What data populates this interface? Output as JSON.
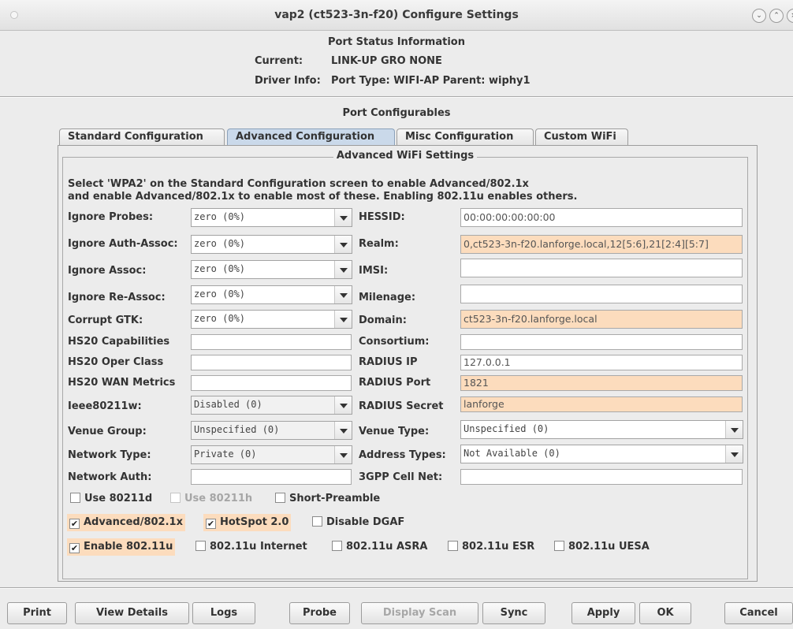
{
  "window": {
    "title": "vap2  (ct523-3n-f20) Configure Settings"
  },
  "status": {
    "heading": "Port Status Information",
    "current_label": "Current:",
    "current_value": "LINK-UP GRO  NONE",
    "driver_label": "Driver Info:",
    "driver_value": "Port Type: WIFI-AP   Parent: wiphy1"
  },
  "configurables": {
    "heading": "Port Configurables",
    "tabs": [
      {
        "label": "Standard Configuration"
      },
      {
        "label": "Advanced Configuration"
      },
      {
        "label": "Misc Configuration"
      },
      {
        "label": "Custom WiFi"
      }
    ],
    "active_tab": "Advanced Configuration"
  },
  "advanced": {
    "group_title": "Advanced WiFi Settings",
    "note_line1": "Select 'WPA2' on the Standard Configuration screen to enable Advanced/802.1x",
    "note_line2": "and enable Advanced/802.1x to enable most of these. Enabling 802.11u enables others.",
    "left": {
      "ignore_probes": {
        "label": "Ignore Probes:",
        "value": "zero (0%)"
      },
      "ignore_auth_assoc": {
        "label": "Ignore Auth-Assoc:",
        "value": "zero (0%)"
      },
      "ignore_assoc": {
        "label": "Ignore Assoc:",
        "value": "zero (0%)"
      },
      "ignore_reassoc": {
        "label": "Ignore Re-Assoc:",
        "value": "zero (0%)"
      },
      "corrupt_gtk": {
        "label": "Corrupt GTK:",
        "value": "zero (0%)"
      },
      "hs20_capabilities": {
        "label": "HS20 Capabilities",
        "value": ""
      },
      "hs20_oper_class": {
        "label": "HS20 Oper Class",
        "value": ""
      },
      "hs20_wan_metrics": {
        "label": "HS20 WAN Metrics",
        "value": ""
      },
      "ieee80211w": {
        "label": "Ieee80211w:",
        "value": "Disabled (0)"
      },
      "venue_group": {
        "label": "Venue Group:",
        "value": "Unspecified (0)"
      },
      "network_type": {
        "label": "Network Type:",
        "value": "Private (0)"
      },
      "network_auth": {
        "label": "Network Auth:",
        "value": ""
      }
    },
    "right": {
      "hessid": {
        "label": "HESSID:",
        "value": "00:00:00:00:00:00"
      },
      "realm": {
        "label": "Realm:",
        "value": "0,ct523-3n-f20.lanforge.local,12[5:6],21[2:4][5:7]"
      },
      "imsi": {
        "label": "IMSI:",
        "value": ""
      },
      "milenage": {
        "label": "Milenage:",
        "value": ""
      },
      "domain": {
        "label": "Domain:",
        "value": "ct523-3n-f20.lanforge.local"
      },
      "consortium": {
        "label": "Consortium:",
        "value": ""
      },
      "radius_ip": {
        "label": "RADIUS IP",
        "value": "127.0.0.1"
      },
      "radius_port": {
        "label": "RADIUS Port",
        "value": "1821"
      },
      "radius_secret": {
        "label": "RADIUS Secret",
        "value": "lanforge"
      },
      "venue_type": {
        "label": "Venue Type:",
        "value": "Unspecified (0)"
      },
      "address_types": {
        "label": "Address Types:",
        "value": "Not Available (0)"
      },
      "cell_net": {
        "label": "3GPP Cell Net:",
        "value": ""
      }
    },
    "checkboxes": {
      "use_80211d": {
        "label": "Use 80211d",
        "checked": false
      },
      "use_80211h": {
        "label": "Use 80211h",
        "checked": false
      },
      "short_preamble": {
        "label": "Short-Preamble",
        "checked": false
      },
      "advanced_8021x": {
        "label": "Advanced/802.1x",
        "checked": true
      },
      "hotspot20": {
        "label": "HotSpot 2.0",
        "checked": true
      },
      "disable_dgaf": {
        "label": "Disable DGAF",
        "checked": false
      },
      "enable_80211u": {
        "label": "Enable 802.11u",
        "checked": true
      },
      "internet": {
        "label": "802.11u Internet",
        "checked": false
      },
      "asra": {
        "label": "802.11u ASRA",
        "checked": false
      },
      "esr": {
        "label": "802.11u ESR",
        "checked": false
      },
      "uesa": {
        "label": "802.11u UESA",
        "checked": false
      }
    },
    "highlight_color": "#fcdcbd"
  },
  "buttons": {
    "print": "Print",
    "view_details": "View Details",
    "logs": "Logs",
    "probe": "Probe",
    "display_scan": "Display Scan",
    "sync": "Sync",
    "apply": "Apply",
    "ok": "OK",
    "cancel": "Cancel"
  }
}
